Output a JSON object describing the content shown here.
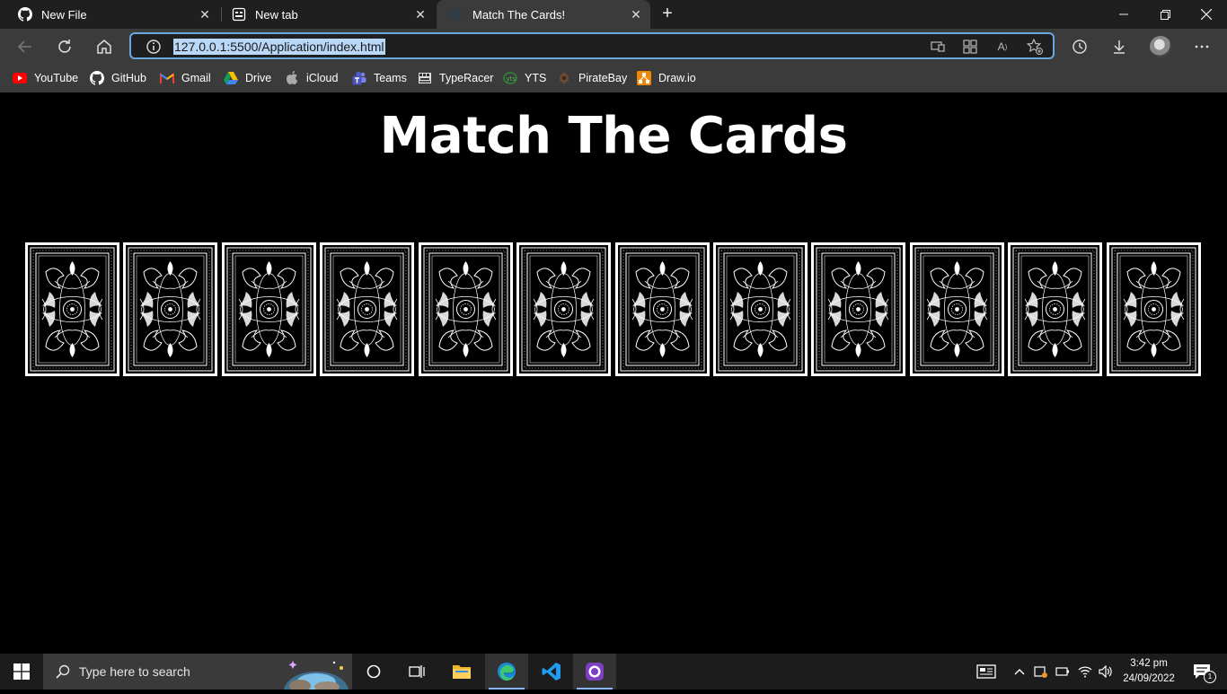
{
  "tabs": [
    {
      "title": "New File",
      "icon": "github-icon",
      "active": false
    },
    {
      "title": "New tab",
      "icon": "new-tab-page-icon",
      "active": false
    },
    {
      "title": "Match The Cards!",
      "icon": "page-icon",
      "active": true
    }
  ],
  "address_bar": {
    "url": "127.0.0.1:5500/Application/index.html"
  },
  "bookmarks": [
    {
      "label": "YouTube",
      "icon": "youtube-icon"
    },
    {
      "label": "GitHub",
      "icon": "github-icon"
    },
    {
      "label": "Gmail",
      "icon": "gmail-icon"
    },
    {
      "label": "Drive",
      "icon": "drive-icon"
    },
    {
      "label": "iCloud",
      "icon": "apple-icon"
    },
    {
      "label": "Teams",
      "icon": "teams-icon"
    },
    {
      "label": "TypeRacer",
      "icon": "typeracer-icon"
    },
    {
      "label": "YTS",
      "icon": "yts-icon"
    },
    {
      "label": "PirateBay",
      "icon": "piratebay-icon"
    },
    {
      "label": "Draw.io",
      "icon": "drawio-icon"
    }
  ],
  "page": {
    "title": "Match The Cards",
    "card_count": 12,
    "cards": [
      "card-back",
      "card-back",
      "card-back",
      "card-back",
      "card-back",
      "card-back",
      "card-back",
      "card-back",
      "card-back",
      "card-back",
      "card-back",
      "card-back"
    ]
  },
  "taskbar": {
    "search_placeholder": "Type here to search",
    "time": "3:42 pm",
    "date": "24/09/2022",
    "notification_count": "1"
  },
  "colors": {
    "page_background": "#000000",
    "chrome_dark": "#1f1f1f",
    "chrome_mid": "#3b3b3b",
    "address_focus": "#6aa6e2",
    "url_selection": "#b9d7f7"
  }
}
